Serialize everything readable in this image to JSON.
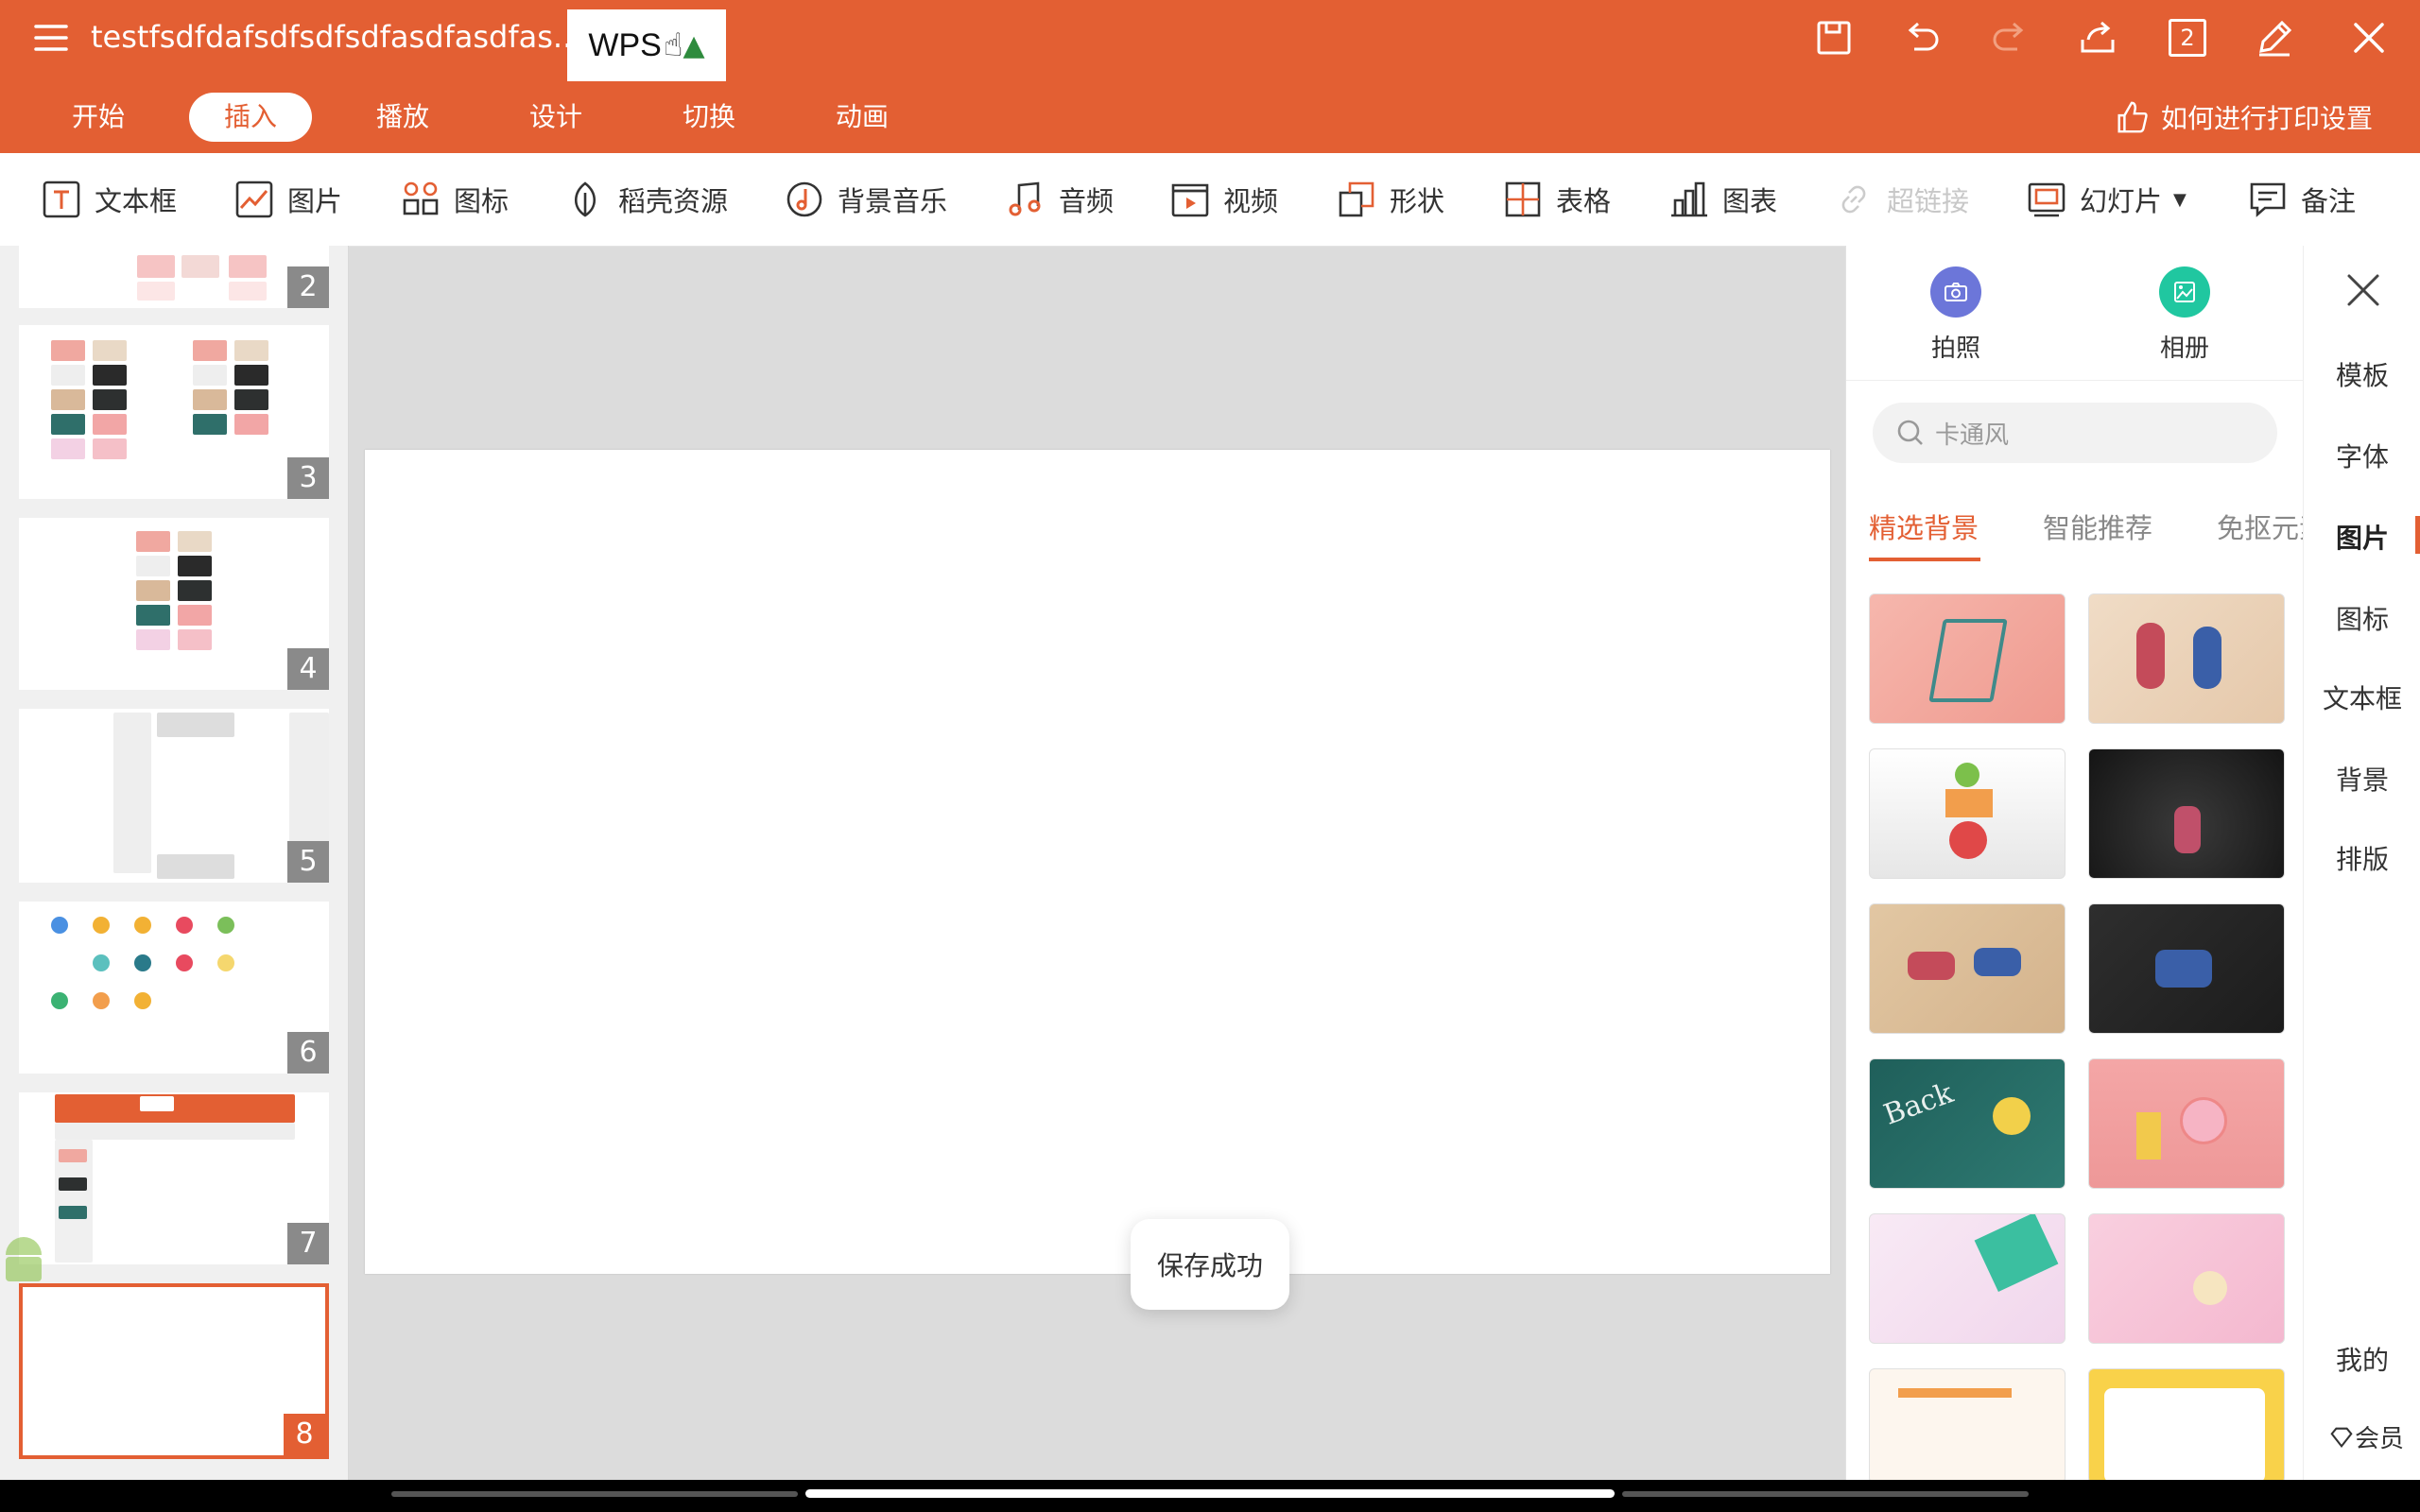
{
  "title_bar": {
    "doc_title": "testfsdfdafsdfsdfsdfasdfasdfas...",
    "wps_badge": "WPS",
    "page_count": "2"
  },
  "tabs": [
    {
      "label": "开始"
    },
    {
      "label": "插入"
    },
    {
      "label": "播放"
    },
    {
      "label": "设计"
    },
    {
      "label": "切换"
    },
    {
      "label": "动画"
    }
  ],
  "help_link": "如何进行打印设置",
  "ribbon": {
    "textbox": "文本框",
    "picture": "图片",
    "icon": "图标",
    "daoke": "稻壳资源",
    "bgmusic": "背景音乐",
    "audio": "音频",
    "video": "视频",
    "shape": "形状",
    "table": "表格",
    "chart": "图表",
    "hyperlink": "超链接",
    "slide": "幻灯片",
    "notes": "备注"
  },
  "slides": [
    "2",
    "3",
    "4",
    "5",
    "6",
    "7",
    "8"
  ],
  "toast": "保存成功",
  "right_panel": {
    "camera": "拍照",
    "album": "相册",
    "search_placeholder": "卡通风",
    "subtabs": [
      "精选背景",
      "智能推荐",
      "免抠元素"
    ]
  },
  "side_nav": [
    "模板",
    "字体",
    "图片",
    "图标",
    "文本框",
    "背景",
    "排版"
  ],
  "side_bottom": {
    "mine": "我的",
    "member": "会员"
  },
  "colors": {
    "accent": "#e35f33"
  }
}
